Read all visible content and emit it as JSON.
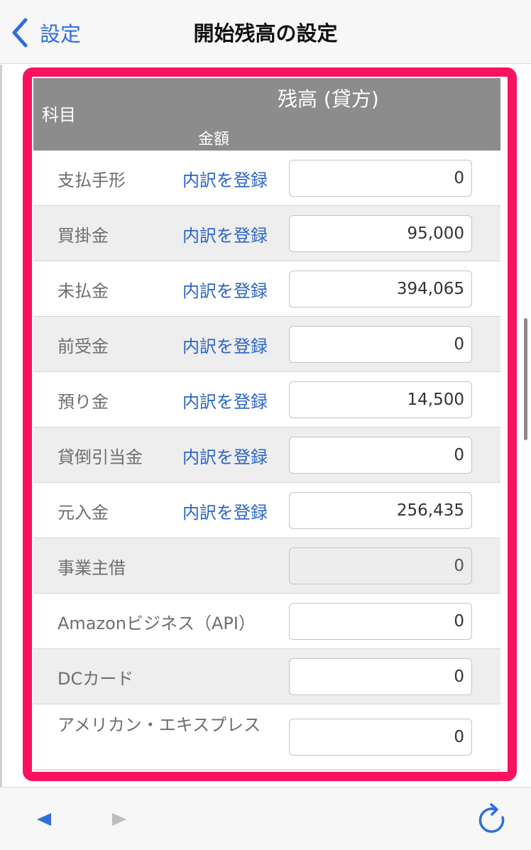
{
  "nav": {
    "back_label": "設定",
    "title": "開始残高の設定"
  },
  "table": {
    "header": {
      "subject": "科目",
      "balance": "残高 (貸方)",
      "amount": "金額"
    },
    "rows": [
      {
        "label": "支払手形",
        "link": "内訳を登録",
        "value": "0"
      },
      {
        "label": "買掛金",
        "link": "内訳を登録",
        "value": "95,000"
      },
      {
        "label": "未払金",
        "link": "内訳を登録",
        "value": "394,065"
      },
      {
        "label": "前受金",
        "link": "内訳を登録",
        "value": "0"
      },
      {
        "label": "預り金",
        "link": "内訳を登録",
        "value": "14,500"
      },
      {
        "label": "貸倒引当金",
        "link": "内訳を登録",
        "value": "0"
      },
      {
        "label": "元入金",
        "link": "内訳を登録",
        "value": "256,435"
      },
      {
        "label": "事業主借",
        "value": "0",
        "disabled": true
      },
      {
        "label": "Amazonビジネス（API）",
        "value": "0"
      },
      {
        "label": "DCカード",
        "value": "0"
      },
      {
        "label": "アメリカン・エキスプレス",
        "value": "0"
      }
    ]
  },
  "toolbar": {
    "back_icon": "triangle-left-icon",
    "forward_icon": "triangle-right-icon",
    "refresh_icon": "refresh-icon"
  },
  "colors": {
    "accent": "#2f6fdc",
    "highlight": "#fa1162",
    "header_bg": "#8c8c8c",
    "link": "#2a63c8"
  }
}
